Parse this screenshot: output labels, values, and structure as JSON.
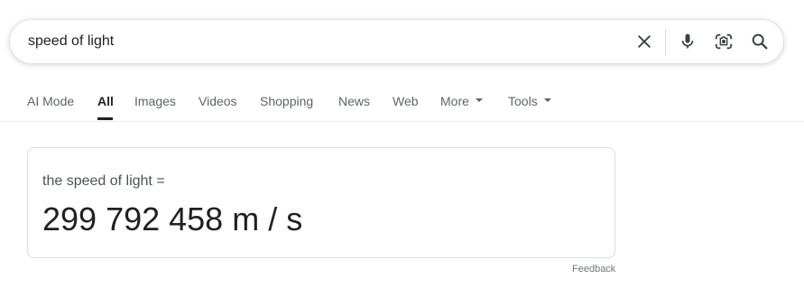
{
  "search": {
    "query": "speed of light"
  },
  "icons": {
    "clear": "close-icon",
    "mic": "microphone-icon",
    "lens": "camera-lens-icon",
    "search": "search-icon"
  },
  "tabs": [
    {
      "label": "AI Mode"
    },
    {
      "label": "All",
      "active": true
    },
    {
      "label": "Images"
    },
    {
      "label": "Videos"
    },
    {
      "label": "Shopping"
    },
    {
      "label": "News"
    },
    {
      "label": "Web"
    },
    {
      "label": "More"
    },
    {
      "label": "Tools"
    }
  ],
  "result": {
    "label": "the speed of light =",
    "value": "299 792 458 m / s"
  },
  "feedback": "Feedback"
}
